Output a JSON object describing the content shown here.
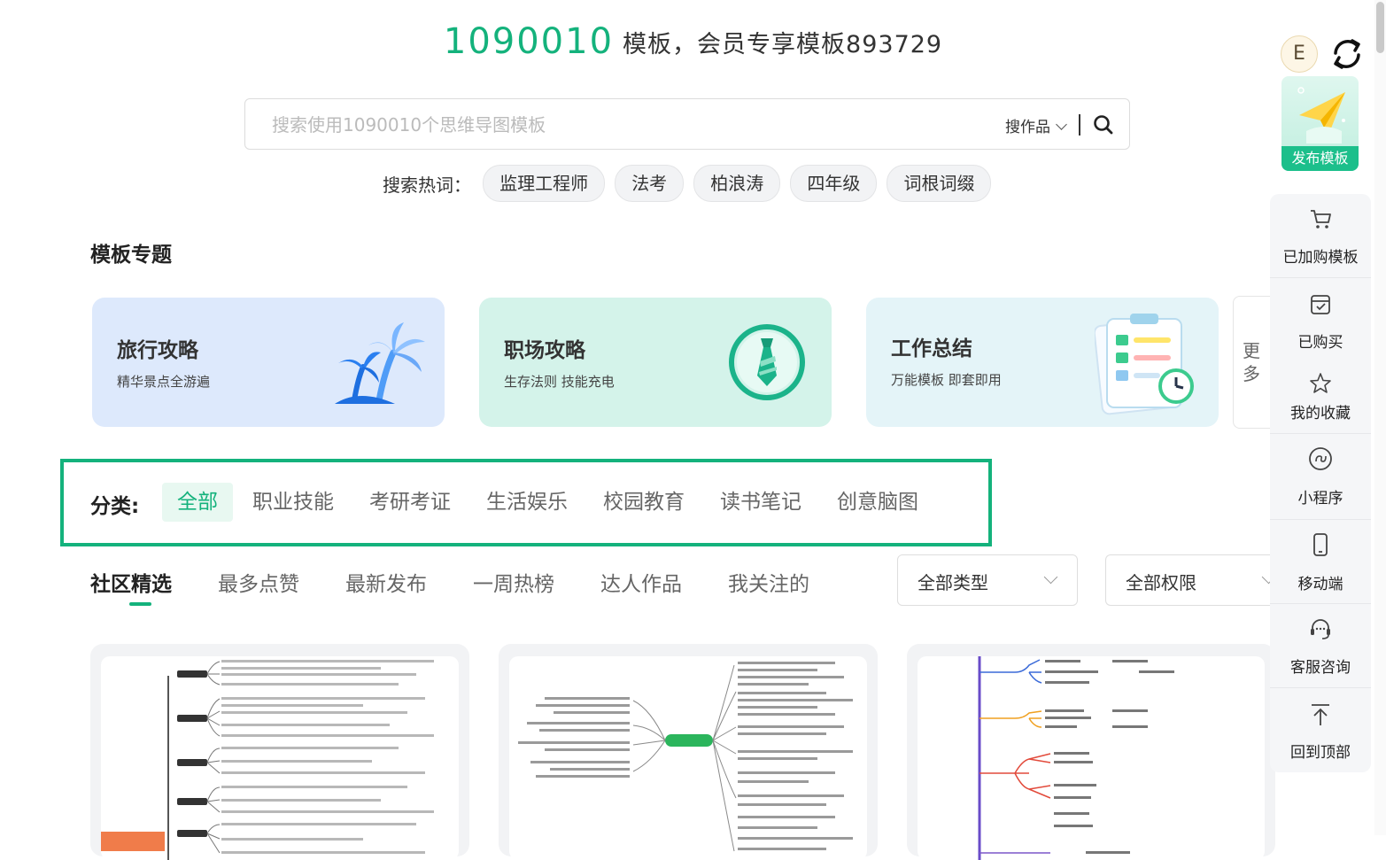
{
  "header": {
    "count": "1090010",
    "text": "模板，会员专享模板893729"
  },
  "search": {
    "placeholder": "搜索使用1090010个思维导图模板",
    "scope": "搜作品"
  },
  "hot": {
    "label": "搜索热词：",
    "tags": [
      "监理工程师",
      "法考",
      "柏浪涛",
      "四年级",
      "词根词缀"
    ]
  },
  "topics": {
    "title": "模板专题",
    "cards": [
      {
        "title": "旅行攻略",
        "subtitle": "精华景点全游遍",
        "bg": "#dde9fc"
      },
      {
        "title": "职场攻略",
        "subtitle": "生存法则 技能充电",
        "bg": "#d4f3ea"
      },
      {
        "title": "工作总结",
        "subtitle": "万能模板 即套即用",
        "bg": "#e4f4f8"
      }
    ],
    "more": "更多"
  },
  "category": {
    "label": "分类:",
    "items": [
      "全部",
      "职业技能",
      "考研考证",
      "生活娱乐",
      "校园教育",
      "读书笔记",
      "创意脑图"
    ],
    "active": 0
  },
  "tabs": {
    "items": [
      "社区精选",
      "最多点赞",
      "最新发布",
      "一周热榜",
      "达人作品",
      "我关注的"
    ],
    "active": 0
  },
  "filters": {
    "type": "全部类型",
    "permission": "全部权限"
  },
  "user": {
    "avatar_letter": "E"
  },
  "publish": {
    "label": "发布模板"
  },
  "rail": [
    {
      "label": "已加购模板",
      "icon": "cart-icon"
    },
    {
      "label": "已购买",
      "icon": "purchased-icon"
    },
    {
      "label": "我的收藏",
      "icon": "star-icon"
    },
    {
      "label": "小程序",
      "icon": "mini-program-icon"
    },
    {
      "label": "移动端",
      "icon": "mobile-icon"
    },
    {
      "label": "客服咨询",
      "icon": "headset-icon"
    },
    {
      "label": "回到顶部",
      "icon": "back-to-top-icon"
    }
  ],
  "colors": {
    "accent": "#14b27c",
    "highlight_border": "#14b27c"
  }
}
